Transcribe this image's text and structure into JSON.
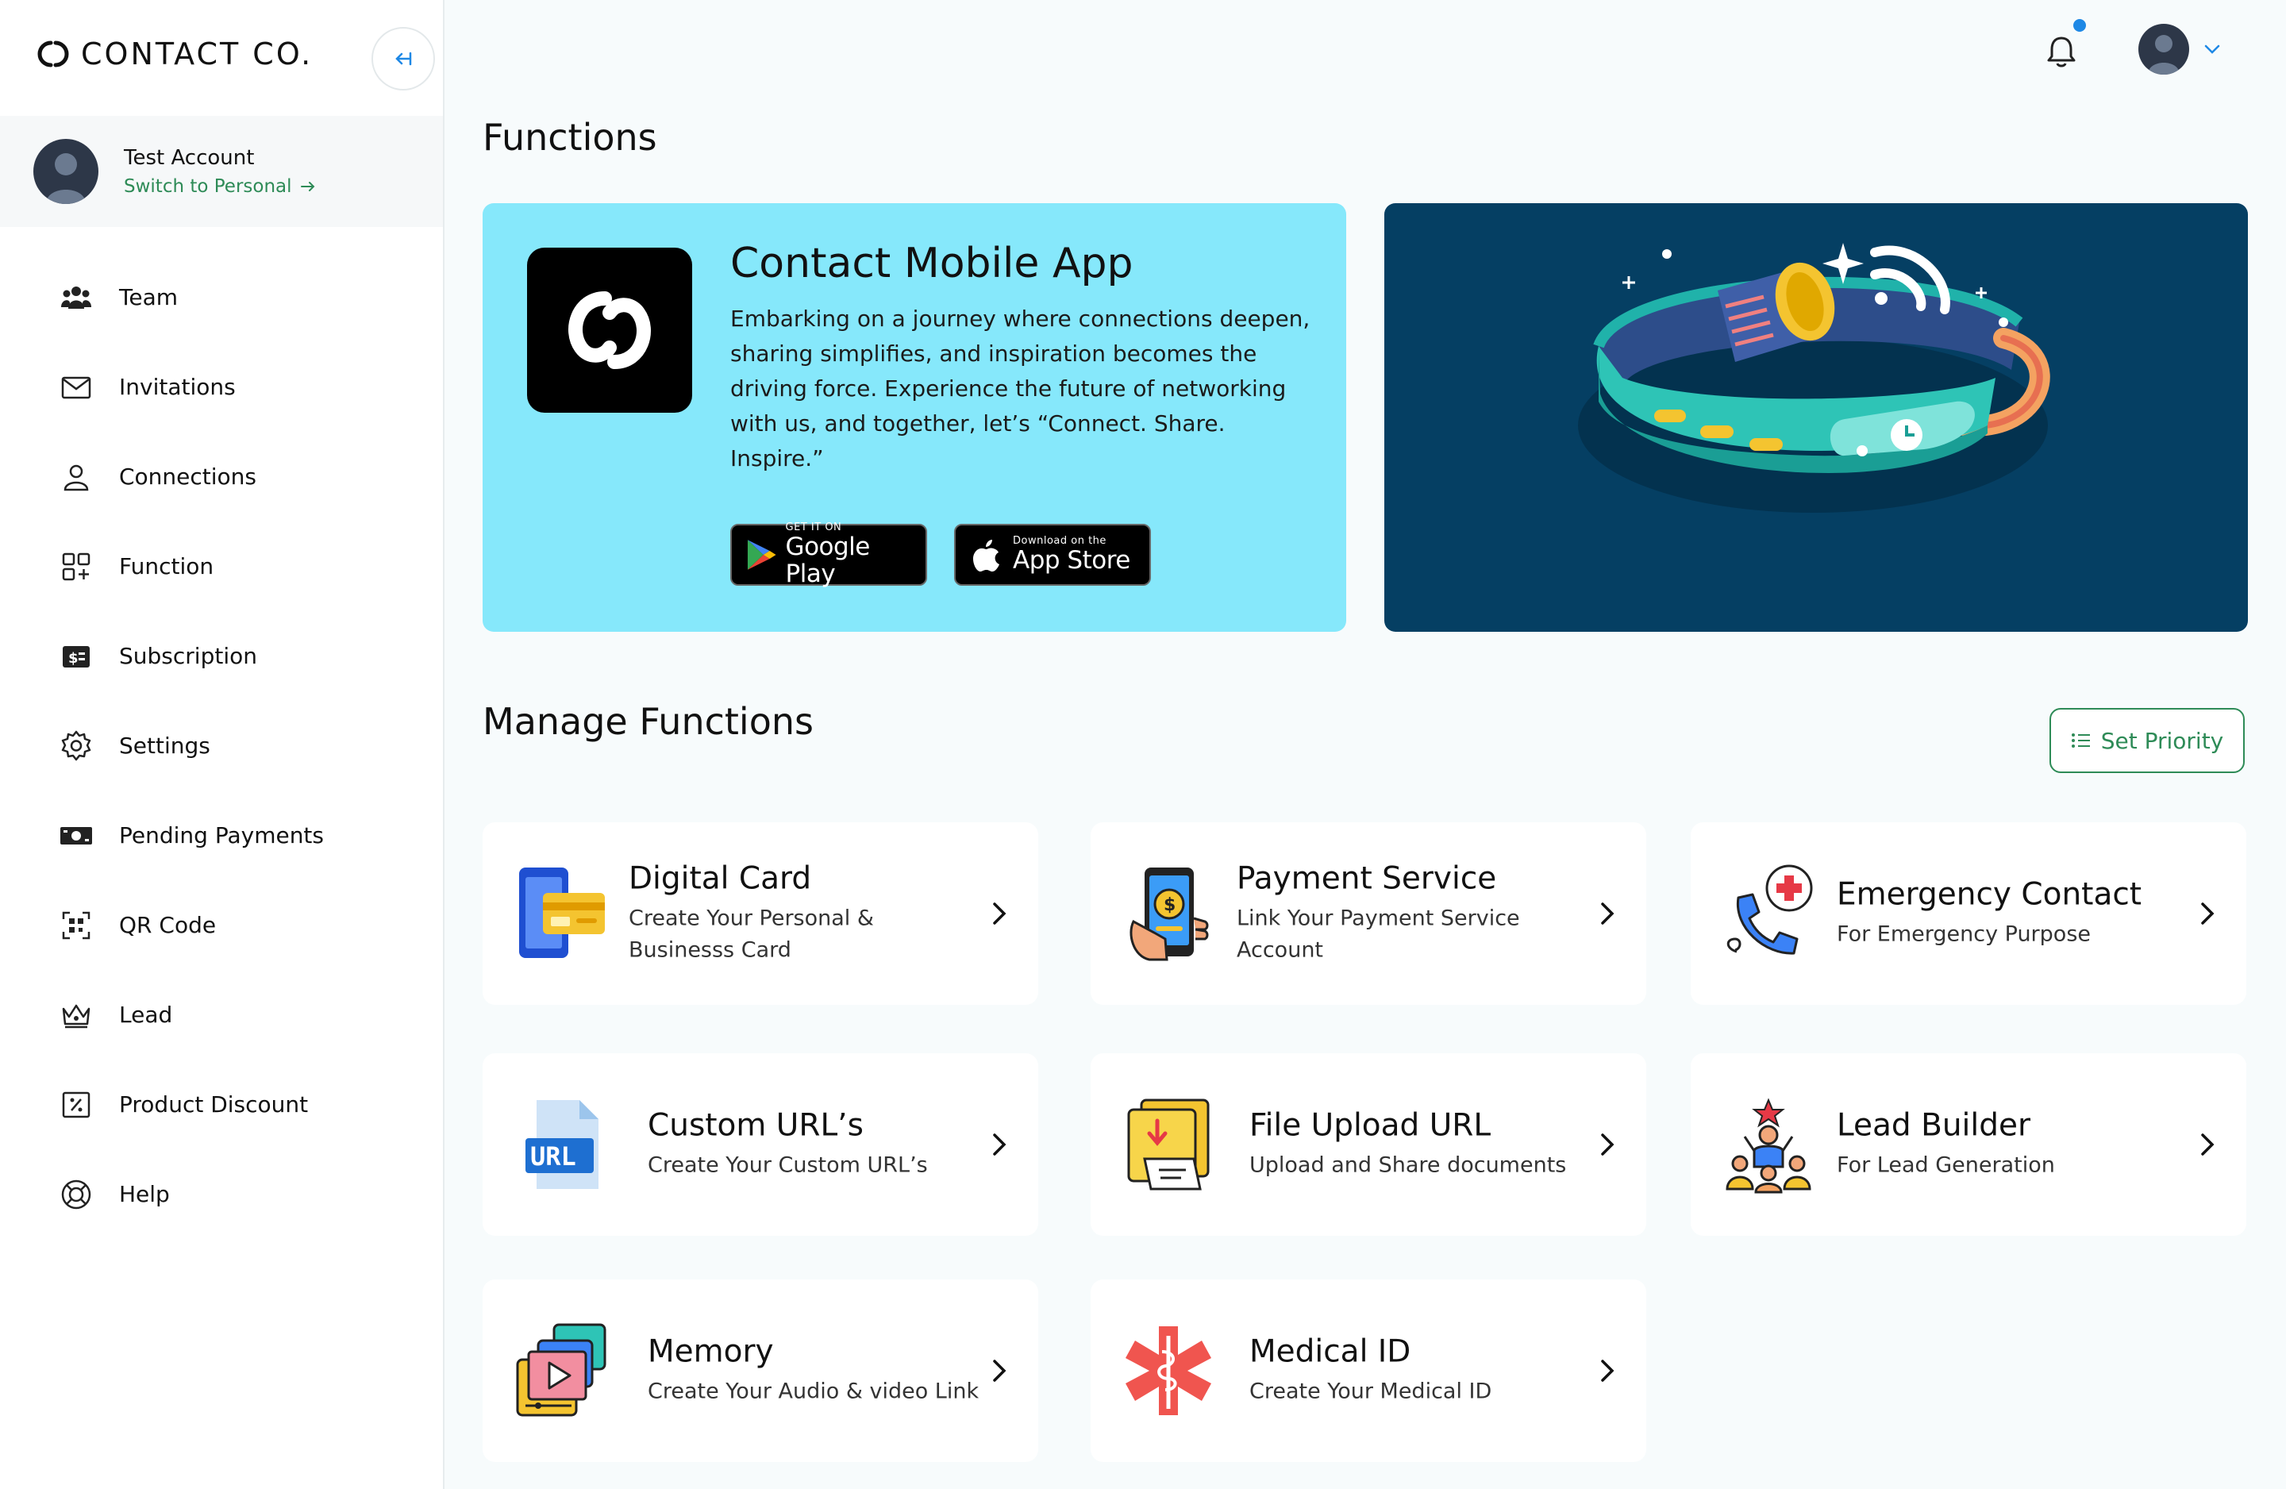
{
  "brand": {
    "name": "CONTACT CO."
  },
  "account": {
    "name": "Test Account",
    "switch_label": "Switch to Personal"
  },
  "nav": {
    "items": [
      {
        "label": "Team",
        "icon": "team-icon"
      },
      {
        "label": "Invitations",
        "icon": "mail-icon"
      },
      {
        "label": "Connections",
        "icon": "user-icon"
      },
      {
        "label": "Function",
        "icon": "grid-add-icon"
      },
      {
        "label": "Subscription",
        "icon": "dollar-card-icon"
      },
      {
        "label": "Settings",
        "icon": "gear-icon"
      },
      {
        "label": "Pending Payments",
        "icon": "money-icon"
      },
      {
        "label": "QR Code",
        "icon": "qr-icon"
      },
      {
        "label": "Lead",
        "icon": "crown-icon"
      },
      {
        "label": "Product Discount",
        "icon": "discount-icon"
      },
      {
        "label": "Help",
        "icon": "lifebuoy-icon"
      }
    ]
  },
  "page": {
    "title": "Functions"
  },
  "app_banner": {
    "title": "Contact Mobile App",
    "description": "Embarking on a journey where connections deepen, sharing simplifies, and inspiration becomes the driving force. Experience the future of networking with us, and together, let’s “Connect. Share. Inspire.”",
    "google_small": "GET IT ON",
    "google_big": "Google Play",
    "apple_small": "Download on the",
    "apple_big": "App Store"
  },
  "manage": {
    "title": "Manage Functions",
    "set_priority_label": "Set Priority",
    "functions": [
      {
        "title": "Digital Card",
        "desc": "Create Your Personal & Businesss Card",
        "icon": "digital-card-icon"
      },
      {
        "title": "Payment Service",
        "desc": "Link Your Payment Service Account",
        "icon": "payment-phone-icon"
      },
      {
        "title": "Emergency Contact",
        "desc": "For Emergency Purpose",
        "icon": "emergency-phone-icon"
      },
      {
        "title": "Custom URL’s",
        "desc": "Create Your Custom URL’s",
        "icon": "url-file-icon"
      },
      {
        "title": "File Upload URL",
        "desc": "Upload and Share documents",
        "icon": "file-upload-icon"
      },
      {
        "title": "Lead Builder",
        "desc": "For Lead Generation",
        "icon": "lead-builder-icon"
      },
      {
        "title": "Memory",
        "desc": "Create Your Audio & video Link",
        "icon": "memory-video-icon"
      },
      {
        "title": "Medical ID",
        "desc": "Create Your Medical ID",
        "icon": "medical-id-icon"
      }
    ]
  },
  "colors": {
    "accent": "#2e8b57",
    "banner": "#86e8fb",
    "promo": "#053f63",
    "notification": "#1e88e5"
  }
}
